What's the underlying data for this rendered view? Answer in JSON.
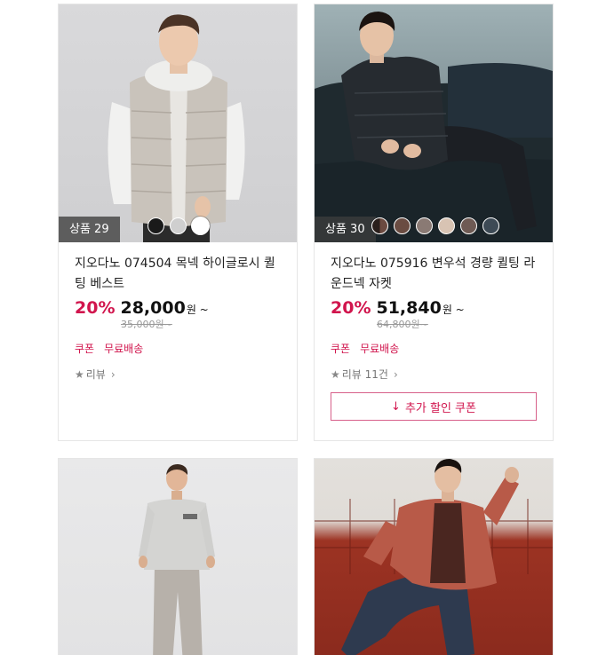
{
  "products": [
    {
      "badge": "상품 29",
      "title": "지오다노 074504 목넥 하이글로시 퀼팅 베스트",
      "discount": "20%",
      "price": "28,000",
      "price_unit": "원 ~",
      "original_price": "35,000원~",
      "tags": [
        "쿠폰",
        "무료배송"
      ],
      "review": "리뷰",
      "swatch_colors": [
        "#1a1a1a",
        "#cfcfcf",
        "#ffffff"
      ],
      "selected_swatch": 2
    },
    {
      "badge": "상품 30",
      "title": "지오다노 075916 변우석 경량 퀼팅 라운드넥 자켓",
      "discount": "20%",
      "price": "51,840",
      "price_unit": "원 ~",
      "original_price": "64,800원~",
      "tags": [
        "쿠폰",
        "무료배송"
      ],
      "review": "리뷰 11건",
      "coupon_button": "추가 할인 쿠폰",
      "swatch_colors": [
        "#5b3d36",
        "#6a4c42",
        "#8a7a74",
        "#d8c3b3",
        "#6e5a54",
        "#3d4a55"
      ]
    }
  ]
}
